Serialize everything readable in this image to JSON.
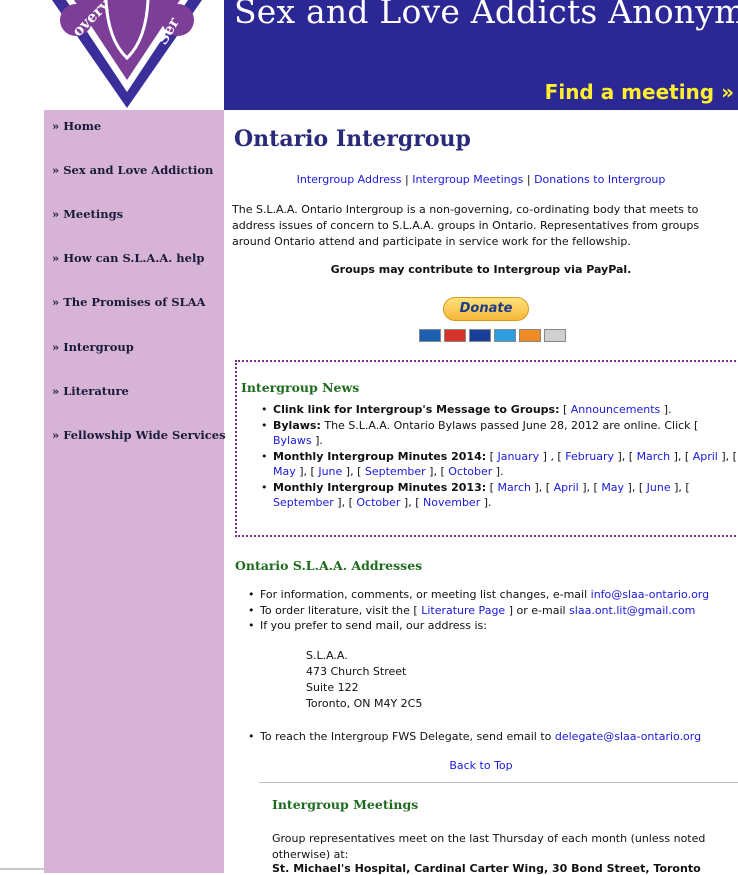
{
  "header": {
    "title": "Sex and Love Addicts Anonymous",
    "find_meeting": "Find a meeting »",
    "logo_fragment_left": "overy",
    "logo_fragment_right": "Ser"
  },
  "sidebar": {
    "items": [
      {
        "label": "» Home"
      },
      {
        "label": "» Sex and Love Addiction"
      },
      {
        "label": "» Meetings"
      },
      {
        "label": "» How can S.L.A.A. help"
      },
      {
        "label": "» The Promises of SLAA"
      },
      {
        "label": "» Intergroup"
      },
      {
        "label": "» Literature"
      },
      {
        "label": "» Fellowship Wide Services"
      }
    ]
  },
  "main": {
    "title": "Ontario Intergroup",
    "quick_links": [
      "Intergroup Address",
      "Intergroup Meetings",
      "Donations to Intergroup"
    ],
    "separator": " | ",
    "intro": "The S.L.A.A. Ontario Intergroup is a non-governing, co-ordinating body that meets to address issues of concern to S.L.A.A. groups in Ontario. Representatives from groups around Ontario attend and participate in service work for the fellowship.",
    "paypal_note": "Groups may contribute to Intergroup via PayPal.",
    "donate_label": "Donate",
    "cards": [
      {
        "name": "maestro",
        "color": "#1d5fb0"
      },
      {
        "name": "mastercard",
        "color": "#d8332b"
      },
      {
        "name": "visa",
        "color": "#1a3f9a"
      },
      {
        "name": "amex",
        "color": "#2f9ee0"
      },
      {
        "name": "discover",
        "color": "#f08a24"
      },
      {
        "name": "bank",
        "color": "#d0d0d0"
      }
    ]
  },
  "news": {
    "heading": "Intergroup News",
    "announce_bold": "Clink link for Intergroup's Message to Groups:",
    "announce_link": "Announcements",
    "bylaws_bold": "Bylaws:",
    "bylaws_text": "The S.L.A.A. Ontario Bylaws passed June 28, 2012 are online. Click",
    "bylaws_link": "Bylaws",
    "minutes_2014_label": "Monthly Intergroup Minutes 2014:",
    "minutes_2014": [
      "January",
      "February",
      "March",
      "April",
      "May",
      "June",
      "September",
      "October"
    ],
    "minutes_2013_label": "Monthly Intergroup Minutes 2013:",
    "minutes_2013": [
      "March",
      "April",
      "May",
      "June",
      "September",
      "October",
      "November"
    ]
  },
  "addresses": {
    "heading": "Ontario S.L.A.A. Addresses",
    "info_text": "For information, comments, or meeting list changes, e-mail",
    "info_email": "info@slaa-ontario.org",
    "lit_text": "To order literature, visit the",
    "lit_link": "Literature Page",
    "lit_mid": "or e-mail",
    "lit_email": "slaa.ont.lit@gmail.com",
    "mail_text": "If you prefer to send mail, our address is:",
    "postal_lines": [
      "S.L.A.A.",
      "473 Church Street",
      "Suite 122",
      "Toronto, ON M4Y 2C5"
    ],
    "delegate_text": "To reach the Intergroup FWS Delegate, send email to",
    "delegate_email": "delegate@slaa-ontario.org",
    "back_to_top": "Back to Top"
  },
  "meetings": {
    "heading": "Intergroup Meetings",
    "text": "Group representatives meet on the last Thursday of each month (unless noted otherwise) at:",
    "location": "St. Michael's Hospital, Cardinal Carter Wing, 30 Bond Street, Toronto"
  },
  "colors": {
    "banner": "#2b2895",
    "sidebar": "#d7b4d5",
    "heading_green": "#1e6b1e",
    "link": "#1a1adb",
    "find_meeting": "#ffef2e",
    "news_border": "#7a2f8a"
  }
}
